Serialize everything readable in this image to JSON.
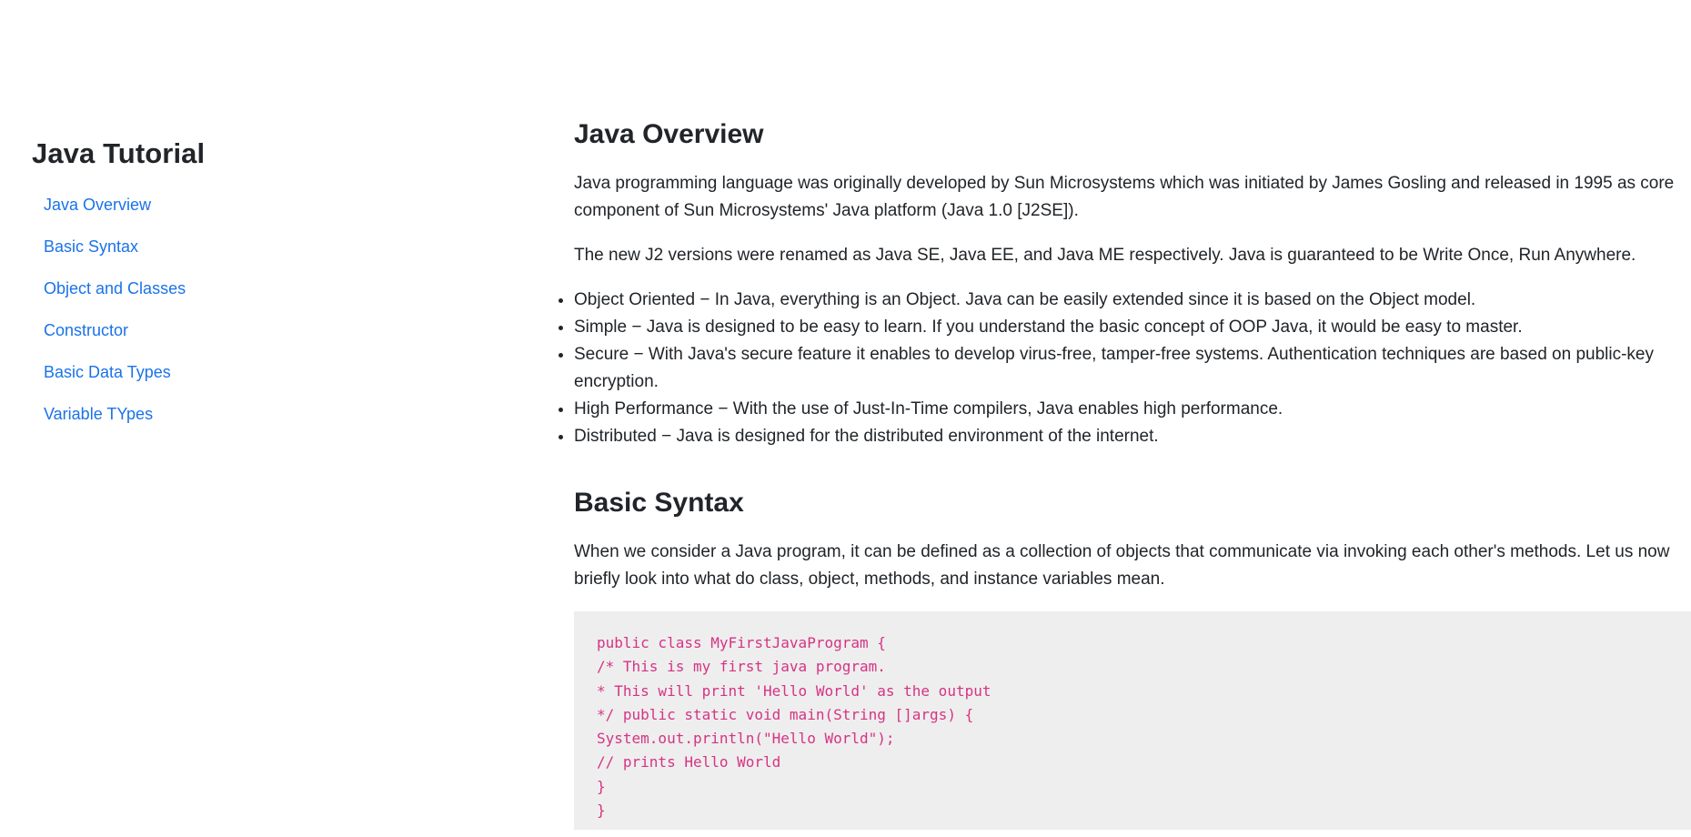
{
  "sidebar": {
    "title": "Java Tutorial",
    "items": [
      {
        "label": "Java Overview"
      },
      {
        "label": "Basic Syntax"
      },
      {
        "label": "Object and Classes"
      },
      {
        "label": "Constructor"
      },
      {
        "label": "Basic Data Types"
      },
      {
        "label": "Variable TYpes"
      }
    ]
  },
  "overview": {
    "heading": "Java Overview",
    "para1": "Java programming language was originally developed by Sun Microsystems which was initiated by James Gosling and released in 1995 as core component of Sun Microsystems' Java platform (Java 1.0 [J2SE]).",
    "para2": "The new J2 versions were renamed as Java SE, Java EE, and Java ME respectively. Java is guaranteed to be Write Once, Run Anywhere.",
    "features": [
      "Object Oriented − In Java, everything is an Object. Java can be easily extended since it is based on the Object model.",
      "Simple − Java is designed to be easy to learn. If you understand the basic concept of OOP Java, it would be easy to master.",
      "Secure − With Java's secure feature it enables to develop virus-free, tamper-free systems. Authentication techniques are based on public-key encryption.",
      "High Performance − With the use of Just-In-Time compilers, Java enables high performance.",
      "Distributed − Java is designed for the distributed environment of the internet."
    ]
  },
  "syntax": {
    "heading": "Basic Syntax",
    "para1": "When we consider a Java program, it can be defined as a collection of objects that communicate via invoking each other's methods. Let us now briefly look into what do class, object, methods, and instance variables mean.",
    "code_lines": [
      "public class MyFirstJavaProgram {",
      "/* This is my first java program.",
      "* This will print 'Hello World' as the output",
      "*/ public static void main(String []args) {",
      "System.out.println(\"Hello World\");",
      "// prints Hello World",
      "}",
      "}"
    ]
  },
  "colors": {
    "link": "#1a73e8",
    "code_text": "#d63384",
    "code_bg": "#eeeeee",
    "text": "#212529"
  }
}
